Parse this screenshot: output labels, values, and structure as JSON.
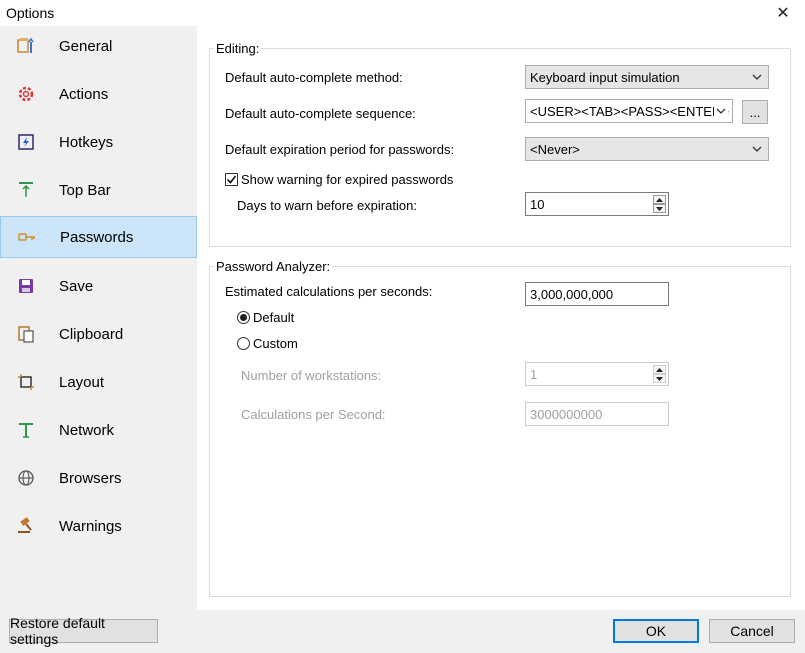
{
  "window": {
    "title": "Options",
    "close_glyph": "✕"
  },
  "sidebar": {
    "items": [
      {
        "label": "General",
        "icon": "general-icon"
      },
      {
        "label": "Actions",
        "icon": "actions-gear-icon"
      },
      {
        "label": "Hotkeys",
        "icon": "hotkeys-icon"
      },
      {
        "label": "Top Bar",
        "icon": "top-bar-icon"
      },
      {
        "label": "Passwords",
        "icon": "passwords-key-icon",
        "selected": true
      },
      {
        "label": "Save",
        "icon": "save-floppy-icon"
      },
      {
        "label": "Clipboard",
        "icon": "clipboard-icon"
      },
      {
        "label": "Layout",
        "icon": "layout-icon"
      },
      {
        "label": "Network",
        "icon": "network-icon"
      },
      {
        "label": "Browsers",
        "icon": "globe-icon"
      },
      {
        "label": "Warnings",
        "icon": "gavel-icon"
      }
    ]
  },
  "editing": {
    "title": "Editing:",
    "autocomplete_method_label": "Default auto-complete method:",
    "autocomplete_method_value": "Keyboard input simulation",
    "autocomplete_sequence_label": "Default auto-complete sequence:",
    "autocomplete_sequence_value": "<USER><TAB><PASS><ENTER>",
    "sequence_button_label": "...",
    "expiration_label": "Default expiration period for passwords:",
    "expiration_value": "<Never>",
    "show_warning_label": "Show warning for expired passwords",
    "show_warning_checked": true,
    "days_warn_label": "Days to warn before expiration:",
    "days_warn_value": "10"
  },
  "analyzer": {
    "title": "Password Analyzer:",
    "calc_label": "Estimated calculations per seconds:",
    "calc_value": "3,000,000,000",
    "radio_default_label": "Default",
    "radio_custom_label": "Custom",
    "selected_radio": "Default",
    "workstations_label": "Number of workstations:",
    "workstations_value": "1",
    "calc_per_second_label": "Calculations per Second:",
    "calc_per_second_value": "3000000000"
  },
  "footer": {
    "restore_label": "Restore default settings",
    "ok_label": "OK",
    "cancel_label": "Cancel"
  },
  "colors": {
    "selected_bg": "#cce4f7",
    "selected_border": "#99c9ef",
    "accent": "#0078d7"
  }
}
